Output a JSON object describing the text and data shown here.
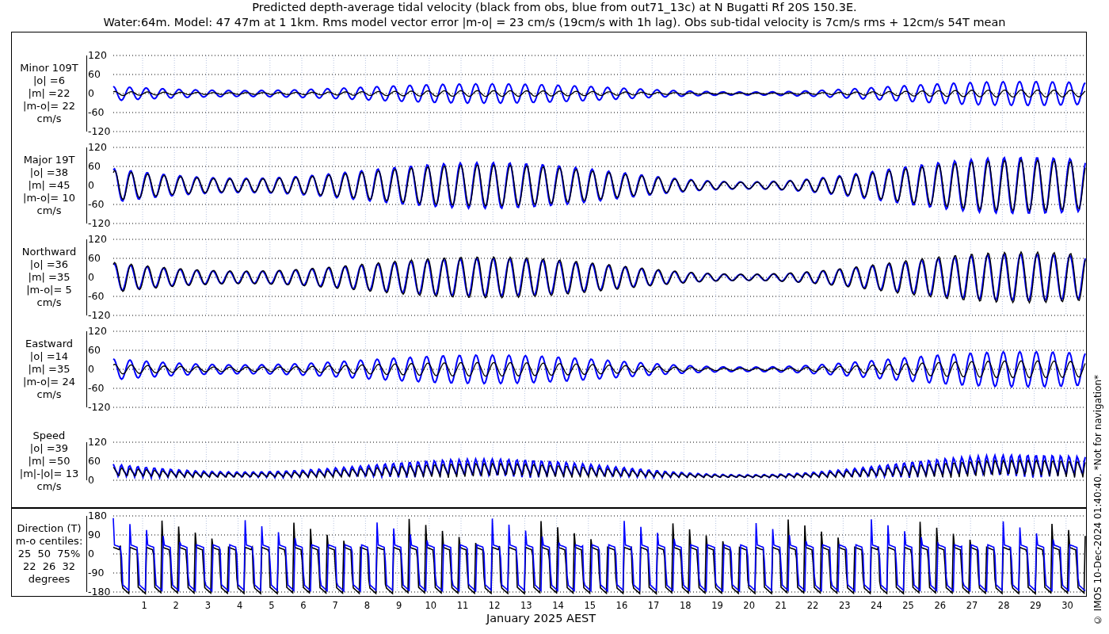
{
  "title_lines": [
    "Predicted depth-average tidal velocity (black from obs, blue from out71_13c) at N Bugatti Rf 20S 150.3E.",
    "Water:64m. Model: 47 47m at 1 1km. Rms model vector error |m-o| = 23 cm/s (19cm/s with 1h lag). Obs sub-tidal velocity is 7cm/s rms + 12cm/s 54T mean"
  ],
  "panels": [
    {
      "kind": "velocity",
      "label": [
        "Minor 109T",
        "|o| =6",
        "|m| =22",
        "|m-o|= 22",
        "cm/s"
      ],
      "ticks": [
        "120",
        "60",
        "0",
        "-60",
        "-120"
      ]
    },
    {
      "kind": "velocity",
      "label": [
        "Major 19T",
        "|o| =38",
        "|m| =45",
        "|m-o|= 10",
        "cm/s"
      ],
      "ticks": [
        "120",
        "60",
        "0",
        "-60",
        "-120"
      ]
    },
    {
      "kind": "velocity",
      "label": [
        "Northward",
        "|o| =36",
        "|m| =35",
        "|m-o|= 5",
        "cm/s"
      ],
      "ticks": [
        "120",
        "60",
        "0",
        "-60",
        "-120"
      ]
    },
    {
      "kind": "velocity",
      "label": [
        "Eastward",
        "|o| =14",
        "|m| =35",
        "|m-o|= 24",
        "cm/s"
      ],
      "ticks": [
        "120",
        "60",
        "0",
        "-60",
        "-120"
      ]
    },
    {
      "kind": "speed",
      "label": [
        "Speed",
        "|o| =39",
        "|m| =50",
        "|m|-|o|= 13",
        "cm/s"
      ],
      "ticks": [
        "120",
        "60",
        "0"
      ]
    },
    {
      "kind": "direction",
      "label": [
        "Direction (T)",
        "m-o centiles:",
        "25  50  75%",
        "22  26  32",
        "degrees"
      ],
      "ticks": [
        "180",
        "90",
        "0",
        "-90",
        "-180"
      ]
    }
  ],
  "x_axis": {
    "day_labels": [
      "1",
      "2",
      "3",
      "4",
      "5",
      "6",
      "7",
      "8",
      "9",
      "10",
      "11",
      "12",
      "13",
      "14",
      "15",
      "16",
      "17",
      "18",
      "19",
      "20",
      "21",
      "22",
      "23",
      "24",
      "25",
      "26",
      "27",
      "28",
      "29",
      "30"
    ],
    "label": "January 2025 AEST"
  },
  "footer": "© IMOS 10-Dec-2024 01:40:40. *Not for navigation*"
}
